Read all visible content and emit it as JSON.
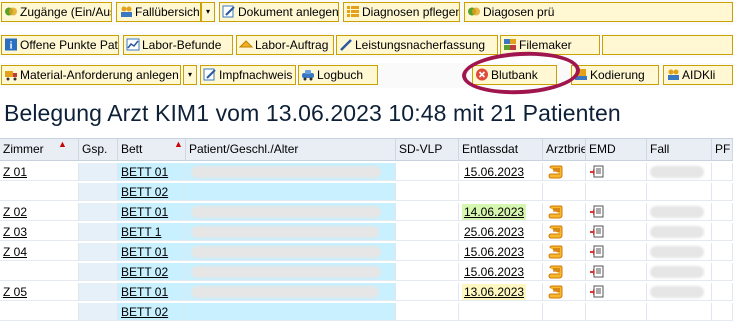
{
  "toolbar_rows": [
    [
      {
        "label": "Zugänge (Ein/Aus)",
        "icon": "transfer-icon"
      },
      {
        "label": "Fallübersicht",
        "icon": "people-icon"
      },
      {
        "label": "",
        "icon": "dropdown-arrow-icon"
      },
      {
        "label": "Dokument anlegen",
        "icon": "pencil-document-icon"
      },
      {
        "label": "Diagnosen pflegen",
        "icon": "list-icon"
      },
      {
        "label": "Diagosen prü",
        "icon": "transfer-icon"
      }
    ],
    [
      {
        "label": "Offene Punkte Pat.",
        "icon": "info-icon"
      },
      {
        "label": "Labor-Befunde",
        "icon": "chart-icon"
      },
      {
        "label": "Labor-Auftrag",
        "icon": "arrow-icon"
      },
      {
        "label": "Leistungsnacherfassung",
        "icon": "pencil-icon"
      },
      {
        "label": "Filemaker",
        "icon": "database-icon"
      },
      {
        "label": "",
        "icon": "more-icon"
      }
    ],
    [
      {
        "label": "Material-Anforderung anlegen",
        "icon": "truck-icon"
      },
      {
        "label": "",
        "icon": "dropdown-arrow-icon"
      },
      {
        "label": "Impfnachweis",
        "icon": "pencil-document-icon"
      },
      {
        "label": "Logbuch",
        "icon": "car-icon"
      },
      {
        "label": "Blutbank",
        "icon": "close-circle-icon"
      },
      {
        "label": "Kodierung",
        "icon": "stamp-icon"
      },
      {
        "label": "AIDKli",
        "icon": "people-icon"
      }
    ]
  ],
  "title": "Belegung Arzt KIM1 vom 13.06.2023 10:48 mit  21 Patienten",
  "columns": [
    "Zimmer",
    "Gsp.",
    "Bett",
    "Patient/Geschl./Alter",
    "SD-VLP",
    "Entlassdat",
    "Arztbrief",
    "EMD",
    "Fall",
    "PF"
  ],
  "rows": [
    {
      "zimmer": "Z 01",
      "bett": "BETT 01",
      "entlass": "15.06.2023",
      "date_color": "#ffffff",
      "arztbrief": true,
      "emd": true,
      "patient": true,
      "fall": true
    },
    {
      "zimmer": "",
      "bett": "BETT 02",
      "entlass": "",
      "date_color": "#ffffff",
      "arztbrief": false,
      "emd": false,
      "patient": false,
      "fall": false
    },
    {
      "zimmer": "Z 02",
      "bett": "BETT 01",
      "entlass": "14.06.2023",
      "date_color": "#d6f7b0",
      "arztbrief": true,
      "emd": true,
      "patient": true,
      "fall": true
    },
    {
      "zimmer": "Z 03",
      "bett": "BETT 1",
      "entlass": "25.06.2023",
      "date_color": "#ffffff",
      "arztbrief": true,
      "emd": true,
      "patient": true,
      "fall": true
    },
    {
      "zimmer": "Z 04",
      "bett": "BETT 01",
      "entlass": "15.06.2023",
      "date_color": "#ffffff",
      "arztbrief": true,
      "emd": true,
      "patient": true,
      "fall": true
    },
    {
      "zimmer": "",
      "bett": "BETT 02",
      "entlass": "15.06.2023",
      "date_color": "#ffffff",
      "arztbrief": true,
      "emd": true,
      "patient": true,
      "fall": true
    },
    {
      "zimmer": "Z 05",
      "bett": "BETT 01",
      "entlass": "13.06.2023",
      "date_color": "#fff7c0",
      "arztbrief": true,
      "emd": true,
      "patient": true,
      "fall": true
    },
    {
      "zimmer": "",
      "bett": "BETT 02",
      "entlass": "",
      "date_color": "#ffffff",
      "arztbrief": false,
      "emd": false,
      "patient": false,
      "fall": false
    }
  ],
  "colors": {
    "highlight_ring": "#a0154e",
    "accent_blue": "#c8f0ff",
    "toolbar_border": "#c9a100"
  }
}
